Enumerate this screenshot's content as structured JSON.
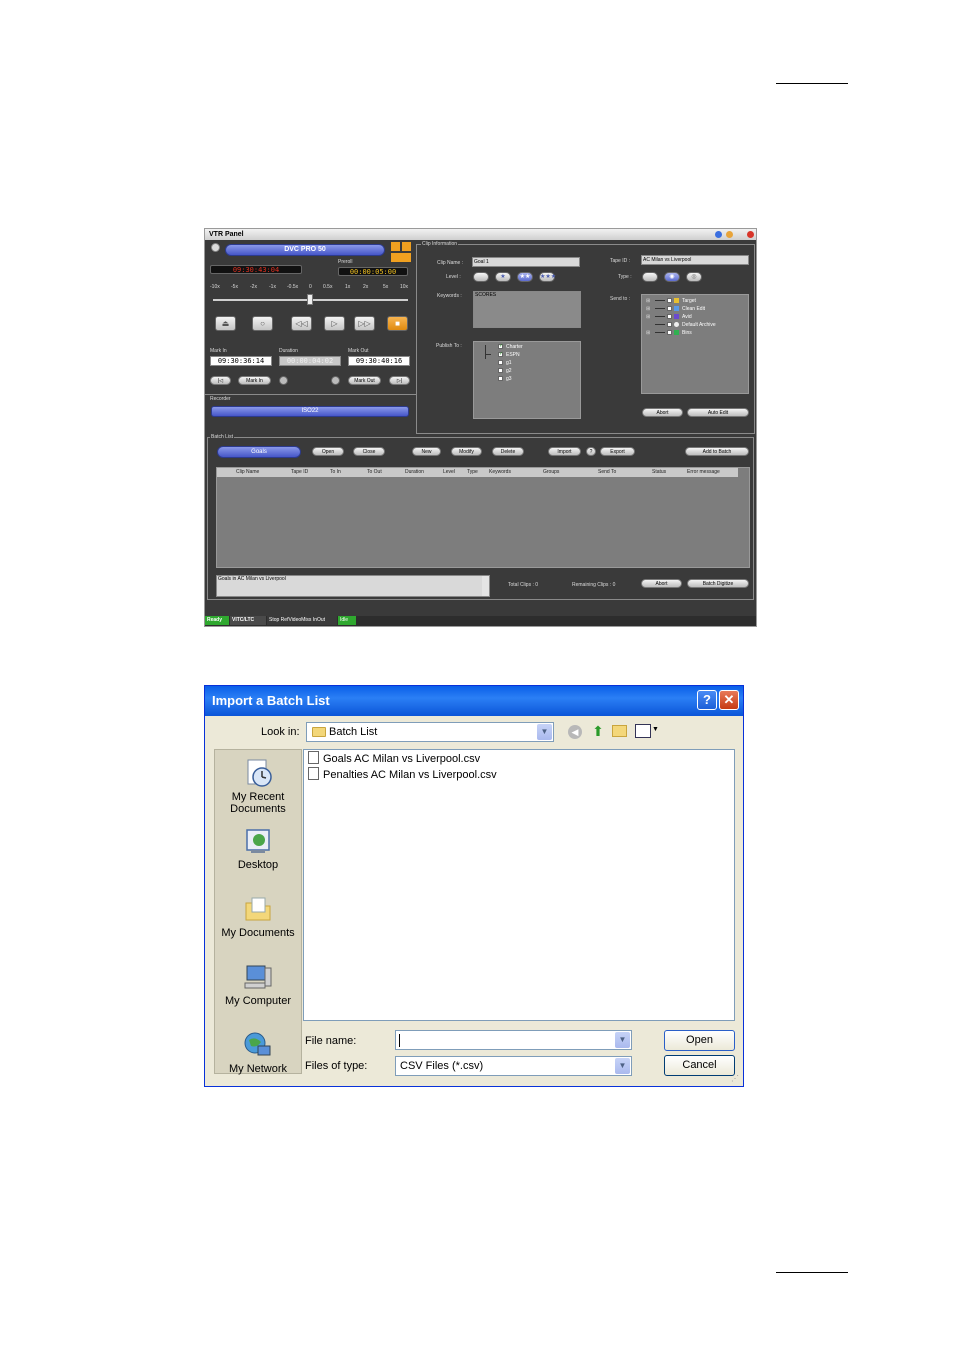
{
  "vtr_panel": {
    "title": "VTR Panel",
    "format": "DVC PRO 50",
    "current_timecode": "09:30:43:04",
    "preroll_label": "Preroll",
    "preroll": "00:00:05:00",
    "shuttle_ticks": [
      "-10x",
      "-5x",
      "-2x",
      "-1x",
      "-0.5x",
      "0",
      "0.5x",
      "1x",
      "2x",
      "5x",
      "10x"
    ],
    "mark_in_label": "Mark In",
    "duration_label": "Duration",
    "mark_out_label": "Mark Out",
    "mark_in": "09:30:36:14",
    "duration": "00:00:04:02",
    "mark_out": "09:30:40:16",
    "mark_in_button": "Mark In",
    "mark_out_button": "Mark Out",
    "recorder_label": "Recorder",
    "recorder": "ISO22",
    "clip_info": {
      "group_label": "Clip Information",
      "clip_name_label": "Clip Name :",
      "clip_name": "Goal 1",
      "level_label": "Level :",
      "keywords_label": "Keywords :",
      "keywords": "SCORES",
      "publish_to_label": "Publish To :",
      "publish_items": [
        {
          "label": "Charter",
          "checked": true
        },
        {
          "label": "ESPN",
          "checked": true
        },
        {
          "label": "g1",
          "checked": false
        },
        {
          "label": "g2",
          "checked": false
        },
        {
          "label": "g3",
          "checked": false
        }
      ],
      "tape_id_label": "Tape ID :",
      "tape_id": "AC Milan vs Liverpool",
      "type_label": "Type :",
      "send_to_label": "Send to :",
      "send_to_items": [
        "Target",
        "Clean Edit",
        "Avid",
        "Default Archive",
        "Bins"
      ],
      "abort_button": "Abort",
      "auto_edit_button": "Auto Edit"
    },
    "batch": {
      "group_label": "Batch List",
      "list_name": "Goals",
      "buttons": [
        "Open",
        "Close",
        "New",
        "Modify",
        "Delete",
        "Import",
        "Export"
      ],
      "help_glyph": "?",
      "add_button": "Add to Batch",
      "columns": [
        "Clip Name",
        "Tape ID",
        "To In",
        "To Out",
        "Duration",
        "Level",
        "Type",
        "Keywords",
        "Groups",
        "Send To",
        "Status",
        "Error message"
      ],
      "description": "Goals in AC Milan vs Liverpool",
      "total_clips": "Total Clips : 0",
      "remaining_clips": "Remaining Clips : 0",
      "abort_button": "Abort",
      "digitize_button": "Batch Digitize"
    },
    "status_bar": [
      "Ready",
      "VITC/LTC",
      "Stop RefVideoMiss InOut",
      "Idle"
    ]
  },
  "import_dialog": {
    "title": "Import a Batch List",
    "help_glyph": "?",
    "close_glyph": "✕",
    "look_in_label": "Look in:",
    "look_in": "Batch List",
    "places": [
      {
        "label": "My Recent Documents",
        "icon": "recent-documents-icon"
      },
      {
        "label": "Desktop",
        "icon": "desktop-icon"
      },
      {
        "label": "My Documents",
        "icon": "my-documents-icon"
      },
      {
        "label": "My Computer",
        "icon": "my-computer-icon"
      },
      {
        "label": "My Network",
        "icon": "network-icon"
      }
    ],
    "files": [
      "Goals AC Milan vs Liverpool.csv",
      "Penalties AC Milan vs Liverpool.csv"
    ],
    "file_name_label": "File name:",
    "file_name": "",
    "files_of_type_label": "Files of type:",
    "files_of_type": "CSV Files (*.csv)",
    "open_button": "Open",
    "cancel_button": "Cancel"
  }
}
